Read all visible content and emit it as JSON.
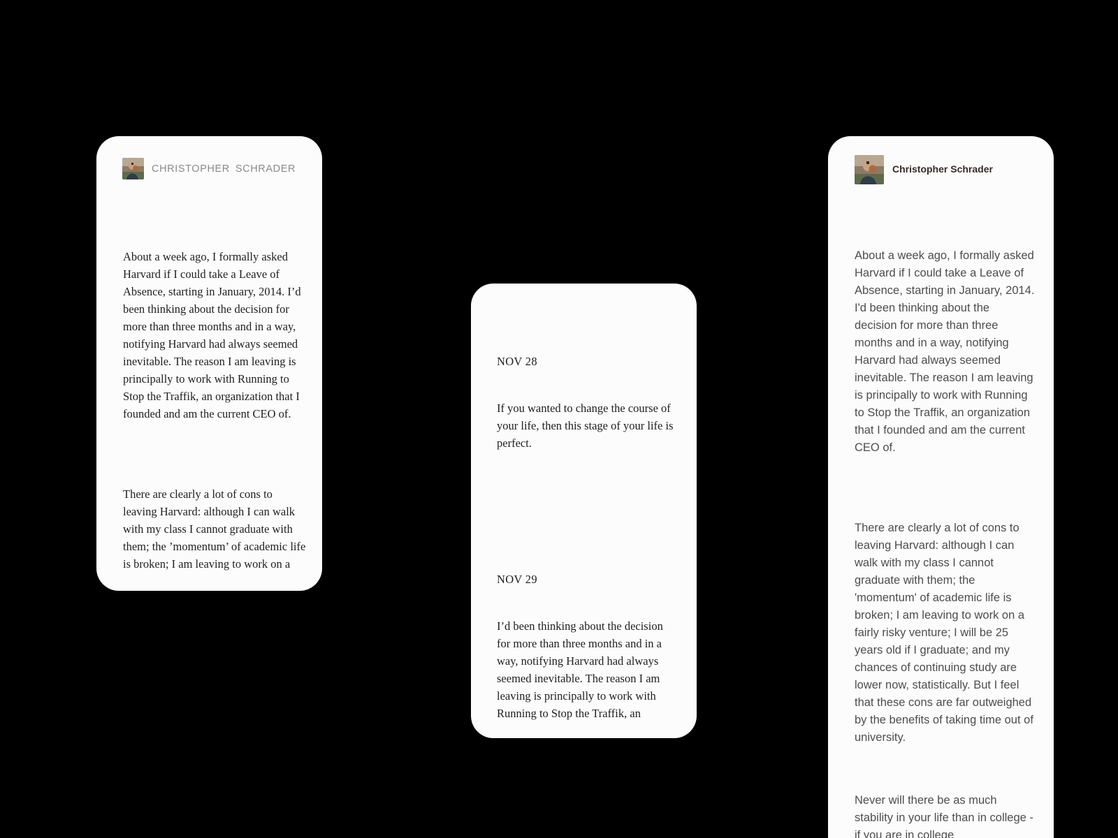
{
  "left_card": {
    "author_first": "CHRISTOPHER",
    "author_last": "SCHRADER",
    "paragraphs": [
      "About a week ago, I formally asked Harvard if I could take a Leave of Absence, starting in January, 2014. I’d been thinking about the decision for more than three months and in a way, notifying Harvard had always seemed inevitable. The reason I am leaving is principally to work with Running to Stop the Traffik, an organization that I founded and am the current CEO of.",
      "There are clearly a lot of cons to leaving Harvard: although I can walk with my class I cannot graduate with them; the ’momentum’ of academic life is broken; I am leaving to work on a"
    ]
  },
  "center_card": {
    "entries": [
      {
        "date": "NOV 28",
        "text": "If you wanted to change the course of your life, then this stage of your life is perfect."
      },
      {
        "date": "NOV 29",
        "text": "I’d been thinking about the decision for more than three months and in a way, notifying Harvard had always seemed inevitable. The reason I am leaving is principally to work with Running to Stop the Traffik, an"
      }
    ]
  },
  "right_card": {
    "author": "Christopher Schrader",
    "paragraphs": [
      "About a week ago, I formally asked Harvard if I could take a Leave of Absence, starting in January, 2014. I'd been thinking about the decision for more than three months and in a way, notifying Harvard had always seemed inevitable. The reason I am leaving is principally to work with Running to Stop the Traffik, an organization that I founded and am the current CEO of.",
      "There are clearly a lot of cons to leaving Harvard: although I can walk with my class I cannot graduate with them; the 'momentum' of academic life is broken; I am leaving to work on a fairly risky venture; I will be 25 years old if I graduate; and my chances of continuing study are lower now, statistically. But I feel that these cons are far outweighed by the benefits of taking time out of university.",
      "Never will there be as much stability in your life than in college - if you are in college"
    ]
  },
  "colors": {
    "background": "#000000",
    "card": "#fcfcfc",
    "caps_author": "#8a8a8a",
    "name_author": "#3a2a24",
    "serif_text": "#1f1f1f",
    "sans_text": "#4d4d4d"
  },
  "icons": {
    "avatar": "author-photo-avatar"
  }
}
